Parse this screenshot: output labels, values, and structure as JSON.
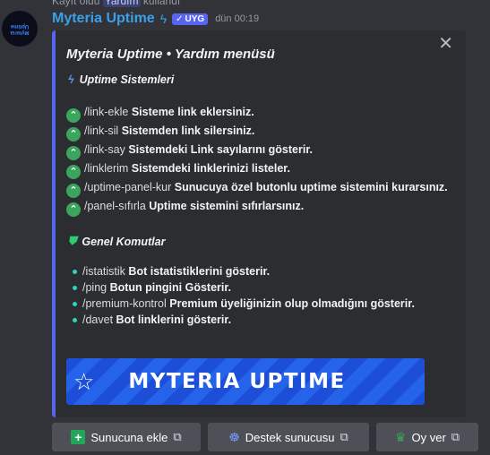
{
  "reply": {
    "prefix": "Kayıt oldu",
    "mention": "Yardım",
    "suffix": "kullandı"
  },
  "message": {
    "username": "Myteria Uptime",
    "bot_badge": "UYG",
    "timestamp": "dün 00:19",
    "avatar_text": "Myteria Uptime"
  },
  "embed": {
    "title": "Myteria Uptime • Yardım menüsü",
    "section1_title": "Uptime Sistemleri",
    "commands": [
      {
        "cmd": "/link-ekle",
        "desc": "Sisteme link eklersiniz."
      },
      {
        "cmd": "/link-sil",
        "desc": "Sistemden link silersiniz."
      },
      {
        "cmd": "/link-say",
        "desc": "Sistemdeki Link sayılarını gösterir."
      },
      {
        "cmd": "/linklerim",
        "desc": "Sistemdeki linklerinizi listeler."
      },
      {
        "cmd": "/uptime-panel-kur",
        "desc": "Sunucuya özel butonlu uptime sistemini kurarsınız."
      },
      {
        "cmd": "/panel-sıfırla",
        "desc": "Uptime sistemini sıfırlarsınız."
      }
    ],
    "section2_title": "Genel Komutlar",
    "general": [
      {
        "cmd": "/istatistik",
        "desc": "Bot istatistiklerini gösterir."
      },
      {
        "cmd": "/ping",
        "desc": "Botun pingini Gösterir."
      },
      {
        "cmd": "/premium-kontrol",
        "desc": "Premium üyeliğinizin olup olmadığını gösterir."
      },
      {
        "cmd": "/davet",
        "desc": "Bot linklerini gösterir."
      }
    ],
    "banner_text": "MYTERIA UPTIME"
  },
  "buttons": [
    {
      "label": "Sunucuna ekle"
    },
    {
      "label": "Destek sunucusu"
    },
    {
      "label": "Oy ver"
    }
  ],
  "colors": {
    "accent": "#5865f2",
    "username": "#3aa0e8",
    "banner": "#2563eb",
    "green": "#23a55a"
  }
}
